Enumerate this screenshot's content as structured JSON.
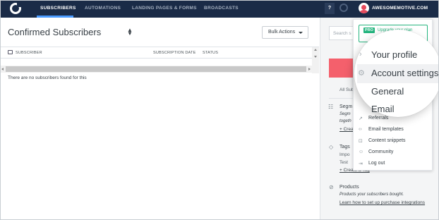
{
  "nav": {
    "items": [
      "SUBSCRIBERS",
      "AUTOMATIONS",
      "LANDING PAGES & FORMS",
      "BROADCASTS"
    ],
    "help_label": "?",
    "account_name": "AWESOMEMOTIVE.COM"
  },
  "main": {
    "title": "Confirmed Subscribers",
    "sorter_glyph": "▲▼",
    "bulk_actions": "Bulk Actions",
    "columns": [
      "SUBSCRIBER",
      "SUBSCRIPTION DATE",
      "STATUS"
    ],
    "empty_message": "There are no subscribers found for this"
  },
  "sidebar": {
    "search_placeholder": "Search s",
    "all_subscribers": "All Sub",
    "segments": {
      "title": "Segm",
      "desc1": "Segm",
      "desc2": "togeth",
      "create": "+ Crea"
    },
    "tags": {
      "title": "Tags",
      "line1": "Impo",
      "line2": "Test",
      "create": "+ Create a Tag"
    },
    "products": {
      "title": "Products",
      "desc": "Products your subscribers bought.",
      "link": "Learn how to set up purchase integrations"
    }
  },
  "dropdown": {
    "pro_badge": "PRO",
    "pro_text": "Upgrade your plan",
    "magnified_items": [
      "Your profile",
      "Account settings",
      "General",
      "Email"
    ],
    "items": [
      "Referrals",
      "Email templates",
      "Content snippets",
      "Community",
      "Log out"
    ]
  },
  "colors": {
    "nav_bg": "#1a2b47",
    "accent_blue": "#4a9bff",
    "pro_green": "#24b47e",
    "red_button": "#f4606c"
  }
}
